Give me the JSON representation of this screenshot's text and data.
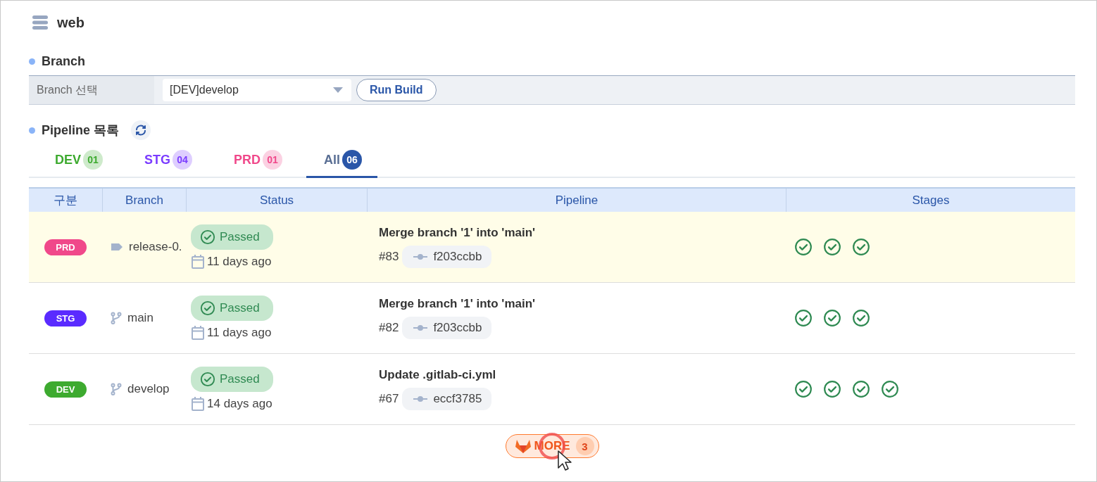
{
  "project": {
    "title": "web"
  },
  "branch_section": {
    "heading": "Branch",
    "field_label": "Branch 선택",
    "select_value": "[DEV]develop",
    "run_button": "Run Build"
  },
  "pipeline_section": {
    "heading": "Pipeline 목록",
    "tabs": [
      {
        "label": "DEV",
        "count": "01",
        "color": "#3daa2f",
        "selected": false
      },
      {
        "label": "STG",
        "count": "04",
        "color": "#7b3cff",
        "selected": false
      },
      {
        "label": "PRD",
        "count": "01",
        "color": "#f0488a",
        "selected": false
      },
      {
        "label": "All",
        "count": "06",
        "color": "#2a56a8",
        "selected": true
      }
    ]
  },
  "table": {
    "columns": [
      "구분",
      "Branch",
      "Status",
      "Pipeline",
      "Stages"
    ],
    "rows": [
      {
        "env": {
          "label": "PRD",
          "color": "#f0488a"
        },
        "ref": {
          "kind": "tag",
          "name": "release-0."
        },
        "status": {
          "kind": "passed",
          "label": "Passed"
        },
        "time": "11 days ago",
        "title": "Merge branch '1' into 'main'",
        "number": "#83",
        "commit": "f203ccbb",
        "highlighted": true,
        "stages": [
          {
            "kind": "passed"
          },
          {
            "kind": "passed"
          },
          {
            "kind": "passed"
          }
        ]
      },
      {
        "env": {
          "label": "STG",
          "color": "#5a2bff"
        },
        "ref": {
          "kind": "branch",
          "name": "main"
        },
        "status": {
          "kind": "passed",
          "label": "Passed"
        },
        "time": "11 days ago",
        "title": "Merge branch '1' into 'main'",
        "number": "#82",
        "commit": "f203ccbb",
        "highlighted": false,
        "stages": [
          {
            "kind": "passed"
          },
          {
            "kind": "passed"
          },
          {
            "kind": "passed"
          }
        ]
      },
      {
        "env": {
          "label": "DEV",
          "color": "#3daa2f"
        },
        "ref": {
          "kind": "branch",
          "name": "develop"
        },
        "status": {
          "kind": "passed",
          "label": "Passed"
        },
        "time": "14 days ago",
        "title": "Update .gitlab-ci.yml",
        "number": "#67",
        "commit": "eccf3785",
        "highlighted": false,
        "stages": [
          {
            "kind": "passed"
          },
          {
            "kind": "passed"
          },
          {
            "kind": "passed"
          },
          {
            "kind": "passed"
          }
        ]
      }
    ]
  },
  "more_button": {
    "label": "MORE",
    "count": "3"
  }
}
